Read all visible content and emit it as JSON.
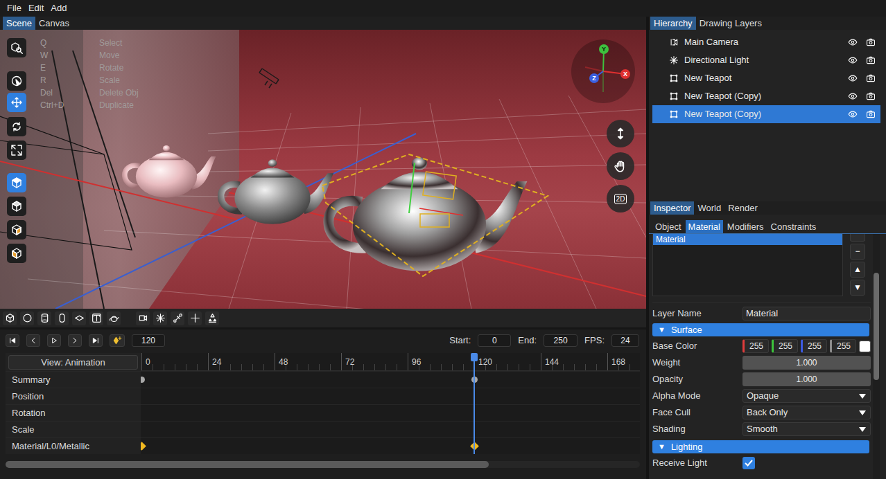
{
  "menu": [
    {
      "label": "File"
    },
    {
      "label": "Edit"
    },
    {
      "label": "Add"
    }
  ],
  "view_tabs": [
    {
      "label": "Scene",
      "selected": true
    },
    {
      "label": "Canvas",
      "selected": false
    }
  ],
  "viewport": {
    "tools": [
      {
        "selected": false
      },
      {
        "selected": false
      },
      {
        "selected": true
      },
      {
        "selected": false
      },
      {
        "selected": false
      },
      {
        "selected": true
      },
      {
        "selected": false
      },
      {
        "selected": false
      },
      {
        "selected": false
      }
    ],
    "shortcuts": [
      {
        "key": "Q",
        "action": "Select"
      },
      {
        "key": "W",
        "action": "Move"
      },
      {
        "key": "E",
        "action": "Rotate"
      },
      {
        "key": "R",
        "action": "Scale"
      },
      {
        "key": "Del",
        "action": "Delete Obj"
      },
      {
        "key": "Ctrl+D",
        "action": "Duplicate"
      }
    ],
    "gizmo": {
      "y": "Y",
      "x": "X",
      "z": "Z"
    },
    "view_2d_label": "2D"
  },
  "timeline": {
    "frame": "120",
    "start_label": "Start:",
    "start": "0",
    "end_label": "End:",
    "end": "250",
    "fps_label": "FPS:",
    "fps": "24",
    "view_button": "View: Animation",
    "ruler": [
      "0",
      "24",
      "48",
      "72",
      "96",
      "120",
      "144",
      "168"
    ],
    "playhead_frame": 120,
    "tracks": [
      {
        "name": "Summary",
        "kind": "summary",
        "keys": [
          0,
          120
        ]
      },
      {
        "name": "Position",
        "kind": "channel",
        "keys": []
      },
      {
        "name": "Rotation",
        "kind": "channel",
        "keys": []
      },
      {
        "name": "Scale",
        "kind": "channel",
        "keys": []
      },
      {
        "name": "Material/L0/Metallic",
        "kind": "channel",
        "keys": [
          0,
          120
        ]
      }
    ]
  },
  "hierarchy": {
    "tabs": [
      {
        "label": "Hierarchy",
        "selected": true
      },
      {
        "label": "Drawing Layers",
        "selected": false
      }
    ],
    "items": [
      {
        "name": "Main Camera",
        "kind": "camera",
        "visible": true,
        "selected": false
      },
      {
        "name": "Directional Light",
        "kind": "light",
        "visible": true,
        "selected": false
      },
      {
        "name": "New Teapot",
        "kind": "mesh",
        "visible": true,
        "selected": false
      },
      {
        "name": "New Teapot (Copy)",
        "kind": "mesh",
        "visible": true,
        "selected": false
      },
      {
        "name": "New Teapot (Copy)",
        "kind": "mesh",
        "visible": true,
        "selected": true
      }
    ]
  },
  "inspector": {
    "tabs": [
      {
        "label": "Inspector",
        "selected": true
      },
      {
        "label": "World",
        "selected": false
      },
      {
        "label": "Render",
        "selected": false
      }
    ],
    "subtabs": [
      {
        "label": "Object",
        "selected": false
      },
      {
        "label": "Material",
        "selected": true
      },
      {
        "label": "Modifiers",
        "selected": false
      },
      {
        "label": "Constraints",
        "selected": false
      }
    ],
    "layers": [
      {
        "name": "Material",
        "selected": true
      }
    ],
    "layer_buttons": [
      "−",
      "▲",
      "▼"
    ],
    "layer_name": {
      "label": "Layer Name",
      "value": "Material"
    },
    "sections": [
      {
        "title": "Surface",
        "toggle": "▼",
        "expanded": true,
        "rows": [
          {
            "kind": "color",
            "label": "Base Color",
            "channels": [
              {
                "value": "255",
                "color": "#e03c3c"
              },
              {
                "value": "255",
                "color": "#3cc43c"
              },
              {
                "value": "255",
                "color": "#3c5ae0"
              },
              {
                "value": "255",
                "color": "#8c8c8c"
              }
            ],
            "swatch": "#ffffff"
          },
          {
            "kind": "slider",
            "label": "Weight",
            "value": "1.000",
            "level": 1
          },
          {
            "kind": "slider",
            "label": "Opacity",
            "value": "1.000",
            "level": 1
          },
          {
            "kind": "dropdown",
            "label": "Alpha Mode",
            "value": "Opaque"
          },
          {
            "kind": "dropdown",
            "label": "Face Cull",
            "value": "Back Only"
          },
          {
            "kind": "dropdown",
            "label": "Shading",
            "value": "Smooth"
          }
        ]
      },
      {
        "title": "Lighting",
        "toggle": "▼",
        "expanded": true,
        "rows": [
          {
            "kind": "checkbox",
            "label": "Receive Light",
            "checked": true
          }
        ]
      }
    ]
  }
}
